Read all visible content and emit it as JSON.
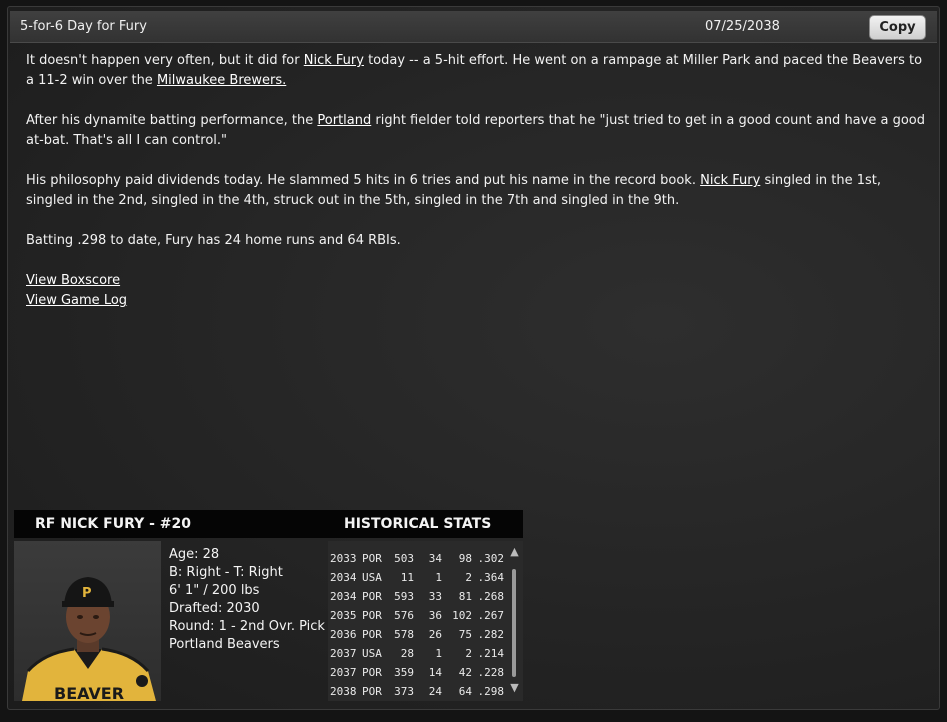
{
  "header": {
    "title": "5-for-6 Day for Fury",
    "date": "07/25/2038",
    "copy_label": "Copy"
  },
  "article": {
    "p1": {
      "t1": "It doesn't happen very often, but it did for ",
      "link1": "Nick Fury",
      "t2": " today -- a 5-hit effort. He went on a rampage at Miller Park and paced the Beavers to a 11-2 win over the ",
      "link2": "Milwaukee Brewers."
    },
    "p2": {
      "t1": "After his dynamite batting performance, the ",
      "link1": "Portland",
      "t2": " right fielder told reporters that he \"just tried to get in a good count and have a good at-bat. That's all I can control.\""
    },
    "p3": {
      "t1": "His philosophy paid dividends today. He slammed 5 hits in 6 tries and put his name in the record book. ",
      "link1": "Nick Fury",
      "t2": " singled in the 1st, singled in the 2nd, singled in the 4th, struck out in the 5th, singled in the 7th and singled in the 9th."
    },
    "p4": "Batting .298 to date, Fury has 24 home runs and 64 RBIs.",
    "link_boxscore": "View Boxscore",
    "link_gamelog": "View Game Log"
  },
  "player": {
    "name": "RF NICK FURY - #20",
    "age": "Age: 28",
    "bats_throws": "B: Right - T: Right",
    "height_weight": "6' 1\" / 200 lbs",
    "drafted": "Drafted: 2030",
    "round": "Round: 1 - 2nd Ovr. Pick",
    "team": "Portland Beavers"
  },
  "historical": {
    "title": "HISTORICAL STATS",
    "rows": [
      {
        "year": "2033",
        "team": "POR",
        "ab": "503",
        "hr": "34",
        "rbi": "98",
        "avg": ".302"
      },
      {
        "year": "2034",
        "team": "USA",
        "ab": "11",
        "hr": "1",
        "rbi": "2",
        "avg": ".364"
      },
      {
        "year": "2034",
        "team": "POR",
        "ab": "593",
        "hr": "33",
        "rbi": "81",
        "avg": ".268"
      },
      {
        "year": "2035",
        "team": "POR",
        "ab": "576",
        "hr": "36",
        "rbi": "102",
        "avg": ".267"
      },
      {
        "year": "2036",
        "team": "POR",
        "ab": "578",
        "hr": "26",
        "rbi": "75",
        "avg": ".282"
      },
      {
        "year": "2037",
        "team": "USA",
        "ab": "28",
        "hr": "1",
        "rbi": "2",
        "avg": ".214"
      },
      {
        "year": "2037",
        "team": "POR",
        "ab": "359",
        "hr": "14",
        "rbi": "42",
        "avg": ".228"
      },
      {
        "year": "2038",
        "team": "POR",
        "ab": "373",
        "hr": "24",
        "rbi": "64",
        "avg": ".298"
      }
    ]
  },
  "icons": {
    "scroll_up": "chevron-up-icon",
    "scroll_down": "chevron-down-icon",
    "player_photo": "player-photo"
  },
  "colors": {
    "background": "#262626",
    "header_bar": "#050505",
    "copy_button": "#e0e0e0"
  }
}
